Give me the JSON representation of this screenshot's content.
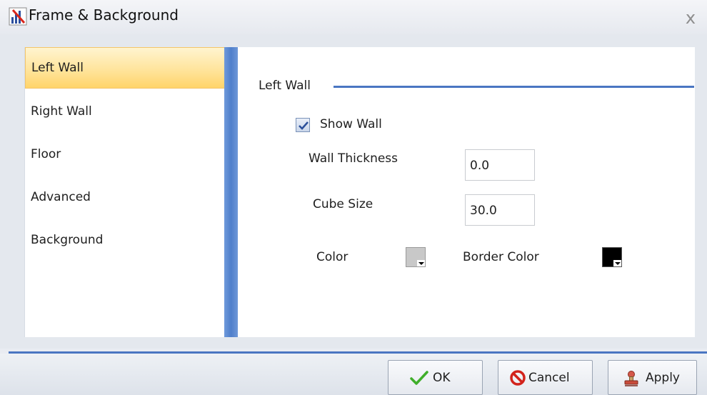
{
  "window": {
    "title": "Frame & Background",
    "close_glyph": "x"
  },
  "nav": {
    "items": [
      {
        "label": "Left Wall",
        "selected": true
      },
      {
        "label": "Right Wall",
        "selected": false
      },
      {
        "label": "Floor",
        "selected": false
      },
      {
        "label": "Advanced",
        "selected": false
      },
      {
        "label": "Background",
        "selected": false
      }
    ]
  },
  "content": {
    "group_title": "Left Wall",
    "show_wall": {
      "label": "Show Wall",
      "checked": true
    },
    "wall_thickness": {
      "label": "Wall Thickness",
      "value": "0.0"
    },
    "cube_size": {
      "label": "Cube Size",
      "value": "30.0"
    },
    "color": {
      "label": "Color",
      "value": "#c8c8c8"
    },
    "border_color": {
      "label": "Border Color",
      "value": "#000000"
    }
  },
  "buttons": {
    "ok": "OK",
    "cancel": "Cancel",
    "apply": "Apply"
  },
  "icons": {
    "title": "chart-app-icon",
    "ok": "checkmark-icon",
    "cancel": "cancel-icon",
    "apply": "apply-stamp-icon"
  },
  "colors": {
    "accent_blue": "#4a76c2",
    "selection_yellow": "#ffd46a"
  }
}
